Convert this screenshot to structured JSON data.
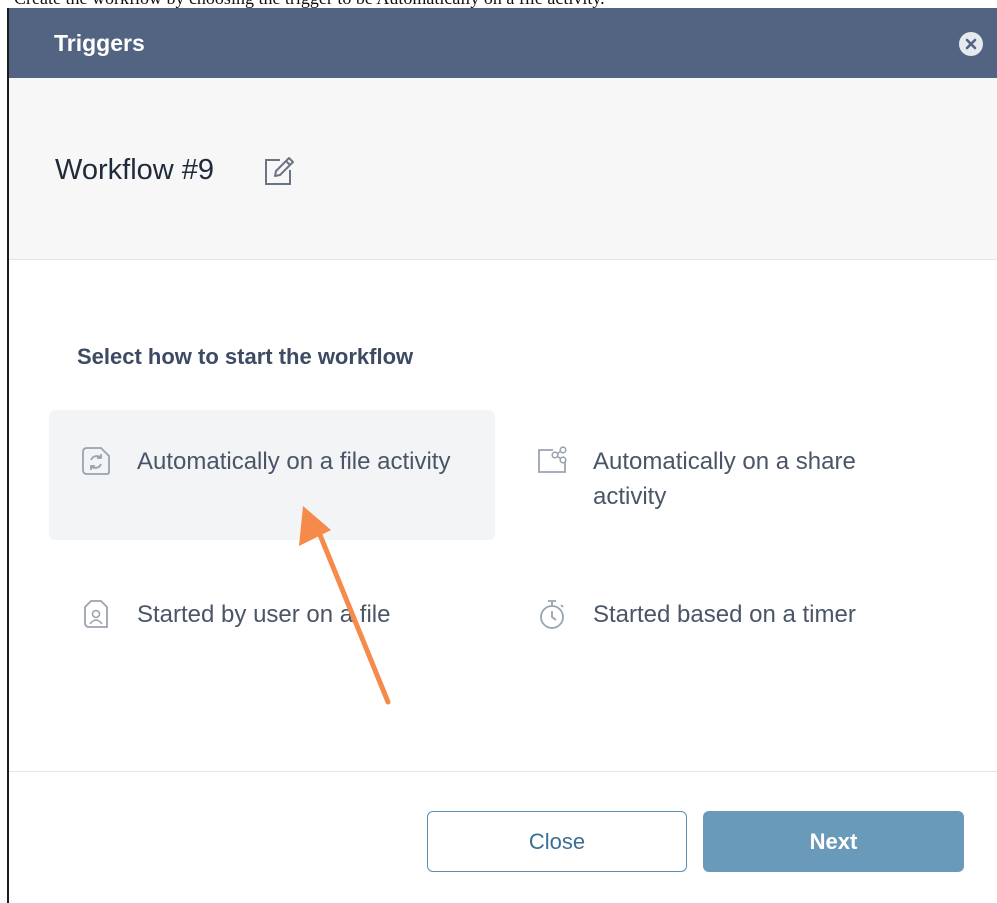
{
  "caption_fragment": "Create the workflow by choosing the trigger to be Automatically on a file activity.",
  "dialog": {
    "title": "Triggers",
    "close_icon": "close-circle-icon"
  },
  "workflow": {
    "name": "Workflow #9",
    "edit_icon": "edit-icon"
  },
  "triggers": {
    "heading": "Select how to start the workflow",
    "selected_index": 0,
    "options": [
      {
        "label": "Automatically on a file activity",
        "icon": "file-sync-icon"
      },
      {
        "label": "Automatically on a share activity",
        "icon": "share-icon"
      },
      {
        "label": "Started by user on a file",
        "icon": "user-file-icon"
      },
      {
        "label": "Started based on a timer",
        "icon": "timer-icon"
      }
    ]
  },
  "footer": {
    "close_label": "Close",
    "next_label": "Next"
  },
  "annotation": {
    "arrow_color": "#f58a4b"
  },
  "colors": {
    "title_bar": "#526482",
    "next_button": "#6a9ab9",
    "close_button_border": "#5b8fb0"
  }
}
